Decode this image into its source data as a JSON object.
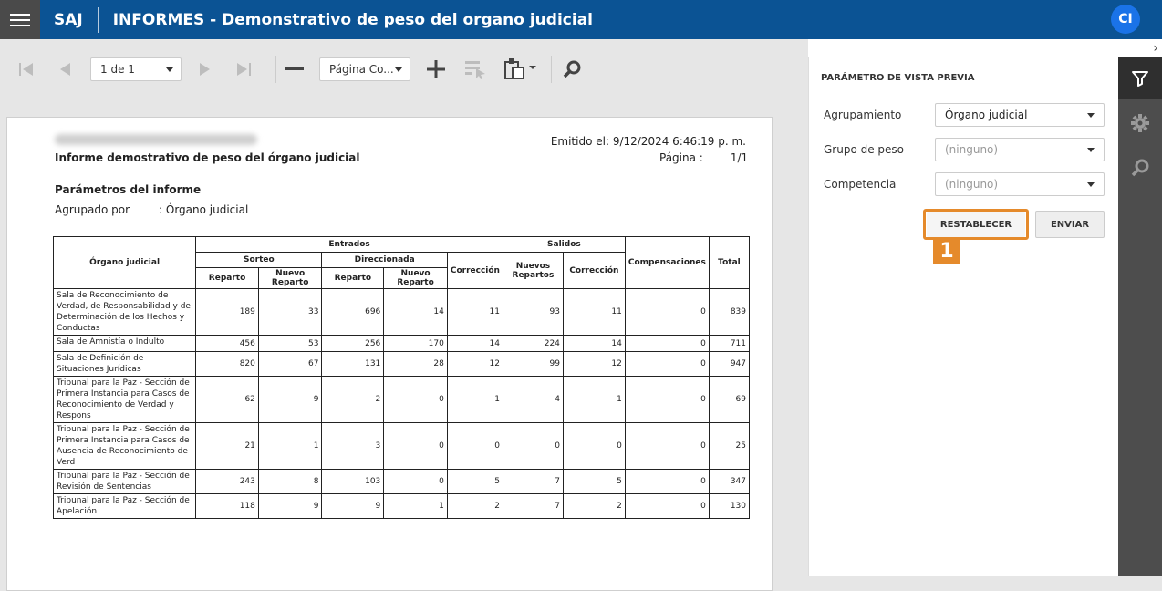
{
  "header": {
    "app": "SAJ",
    "title": "INFORMES - Demonstrativo de peso del organo judicial",
    "avatar": "CI"
  },
  "toolbar": {
    "page_select": "1 de 1",
    "zoom_select": "Página Co..."
  },
  "report": {
    "title": "Informe demostrativo de peso del órgano judicial",
    "emitted": "Emitido el: 9/12/2024 6:46:19 p. m.",
    "page_label": "Página :",
    "page_value": "1/1",
    "params_title": "Parámetros del informe",
    "grouped_label": "Agrupado por",
    "grouped_value": ": Órgano judicial",
    "table": {
      "h_org": "Órgano judicial",
      "h_entradas": "Entrados",
      "h_salidas": "Salidos",
      "h_comp": "Compensaciones",
      "h_total": "Total",
      "h_sorteo": "Sorteo",
      "h_direccionada": "Direccionada",
      "h_correccion": "Corrección",
      "h_nuevos": "Nuevos Repartos",
      "h_correccion2": "Corrección",
      "h_reparto": "Reparto",
      "h_nuevo_reparto": "Nuevo Reparto",
      "h_reparto2": "Reparto",
      "h_nuevo_reparto2": "Nuevo Reparto",
      "rows": [
        {
          "name": "Sala de Reconocimiento de Verdad, de Responsabilidad y de Determinación de los Hechos y Conductas",
          "v": [
            "189",
            "33",
            "696",
            "14",
            "11",
            "93",
            "11",
            "0",
            "839"
          ]
        },
        {
          "name": "Sala de Amnistía o Indulto",
          "v": [
            "456",
            "53",
            "256",
            "170",
            "14",
            "224",
            "14",
            "0",
            "711"
          ]
        },
        {
          "name": "Sala de Definición de Situaciones Jurídicas",
          "v": [
            "820",
            "67",
            "131",
            "28",
            "12",
            "99",
            "12",
            "0",
            "947"
          ]
        },
        {
          "name": "Tribunal para la Paz - Sección de Primera Instancia para Casos de Reconocimiento de Verdad y Respons",
          "v": [
            "62",
            "9",
            "2",
            "0",
            "1",
            "4",
            "1",
            "0",
            "69"
          ]
        },
        {
          "name": "Tribunal para la Paz - Sección de Primera Instancia para Casos de Ausencia de Reconocimiento de Verd",
          "v": [
            "21",
            "1",
            "3",
            "0",
            "0",
            "0",
            "0",
            "0",
            "25"
          ]
        },
        {
          "name": "Tribunal para la Paz - Sección de Revisión de Sentencias",
          "v": [
            "243",
            "8",
            "103",
            "0",
            "5",
            "7",
            "5",
            "0",
            "347"
          ]
        },
        {
          "name": "Tribunal para la Paz - Sección de Apelación",
          "v": [
            "118",
            "9",
            "9",
            "1",
            "2",
            "7",
            "2",
            "0",
            "130"
          ]
        }
      ]
    }
  },
  "panel": {
    "title": "PARÁMETRO DE VISTA PREVIA",
    "agrupamiento_label": "Agrupamiento",
    "agrupamiento_value": "Órgano judicial",
    "grupo_label": "Grupo de peso",
    "grupo_value": "(ninguno)",
    "competencia_label": "Competencia",
    "competencia_value": "(ninguno)",
    "reset_label": "RESTABLECER",
    "send_label": "ENVIAR",
    "badge": "1"
  }
}
